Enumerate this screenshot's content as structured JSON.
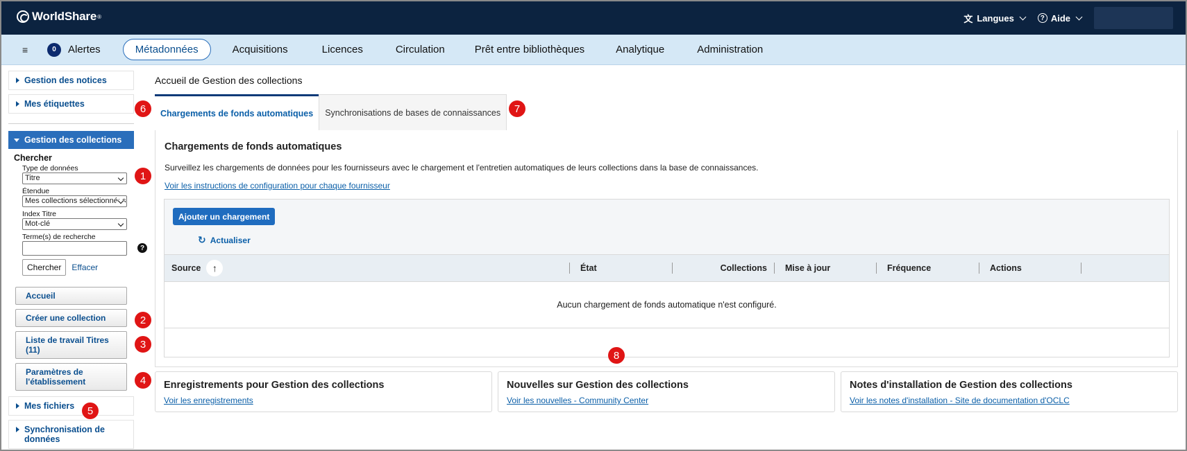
{
  "header": {
    "logo_text": "WorldShare",
    "logo_mark": "®",
    "languages_label": "Langues",
    "help_label": "Aide"
  },
  "nav": {
    "alerts_count": "0",
    "alerts_label": "Alertes",
    "items": [
      "Métadonnées",
      "Acquisitions",
      "Licences",
      "Circulation",
      "Prêt entre bibliothèques",
      "Analytique",
      "Administration"
    ]
  },
  "sidebar": {
    "record_management": "Gestion des notices",
    "my_labels": "Mes étiquettes",
    "collection_management": "Gestion des collections",
    "search": {
      "title": "Chercher",
      "data_type_label": "Type de données",
      "data_type_value": "Titre",
      "scope_label": "Étendue",
      "scope_value": "Mes collections sélectionnées",
      "index_label": "Index Titre",
      "index_value": "Mot-clé",
      "terms_label": "Terme(s) de recherche",
      "terms_value": "",
      "search_button": "Chercher",
      "clear_link": "Effacer"
    },
    "buttons": {
      "home": "Accueil",
      "create_collection": "Créer une collection",
      "title_worklist": "Liste de travail Titres (11)",
      "institution_settings": "Paramètres de l'établissement"
    },
    "my_files": "Mes fichiers",
    "data_sync": "Synchronisation de données"
  },
  "main": {
    "title": "Accueil de Gestion des collections",
    "tabs": [
      "Chargements de fonds automatiques",
      "Synchronisations de bases de connaissances"
    ],
    "section_title": "Chargements de fonds automatiques",
    "description": "Surveillez les chargements de données pour les fournisseurs avec le chargement et l'entretien automatiques de leurs collections dans la base de connaissances.",
    "instructions_link": "Voir les instructions de configuration pour chaque fournisseur",
    "add_button": "Ajouter un chargement",
    "refresh_label": "Actualiser",
    "table": {
      "columns": [
        "Source",
        "État",
        "Collections",
        "Mise à jour",
        "Fréquence",
        "Actions"
      ],
      "empty_message": "Aucun chargement de fonds automatique n'est configuré."
    },
    "cards": [
      {
        "title": "Enregistrements pour Gestion des collections",
        "link": "Voir les enregistrements"
      },
      {
        "title": "Nouvelles sur Gestion des collections",
        "link": "Voir les nouvelles - Community Center"
      },
      {
        "title": "Notes d'installation de Gestion des collections",
        "link": "Voir les notes d'installation - Site de documentation d'OCLC"
      }
    ]
  },
  "callouts": [
    "1",
    "2",
    "3",
    "4",
    "5",
    "6",
    "7",
    "8"
  ]
}
